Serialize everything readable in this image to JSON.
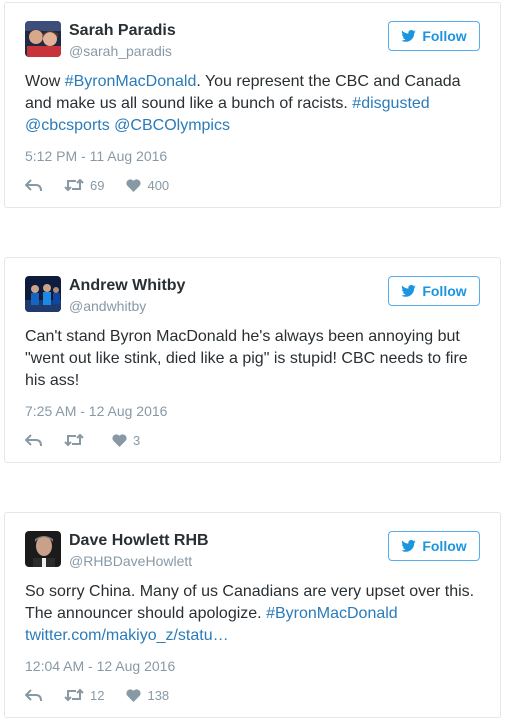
{
  "tweets": [
    {
      "name": "Sarah Paradis",
      "handle": "@sarah_paradis",
      "follow_label": "Follow",
      "body": [
        {
          "text": "Wow ",
          "link": false
        },
        {
          "text": "#ByronMacDonald",
          "link": true
        },
        {
          "text": ". You represent the CBC and Canada and make us all sound like a bunch of racists. ",
          "link": false
        },
        {
          "text": "#disgusted",
          "link": true
        },
        {
          "text": " ",
          "link": false
        },
        {
          "text": "@cbcsports",
          "link": true
        },
        {
          "text": " ",
          "link": false
        },
        {
          "text": "@CBCOlympics",
          "link": true
        }
      ],
      "timestamp": "5:12 PM - 11 Aug 2016",
      "retweets": "69",
      "likes": "400"
    },
    {
      "name": "Andrew Whitby",
      "handle": "@andwhitby",
      "follow_label": "Follow",
      "body": [
        {
          "text": "Can't stand Byron MacDonald he's always been annoying but \"went out like stink, died like a pig\" is stupid! CBC needs to fire his ass!",
          "link": false
        }
      ],
      "timestamp": "7:25 AM - 12 Aug 2016",
      "retweets": "",
      "likes": "3"
    },
    {
      "name": "Dave Howlett RHB",
      "handle": "@RHBDaveHowlett",
      "follow_label": "Follow",
      "body": [
        {
          "text": "So sorry China. Many of us Canadians are very upset over this. The announcer should apologize. ",
          "link": false
        },
        {
          "text": "#ByronMacDonald",
          "link": true
        },
        {
          "text": " ",
          "link": false
        },
        {
          "text": "twitter.com/makiyo_z/statu…",
          "link": true
        }
      ],
      "timestamp": "12:04 AM - 12 Aug 2016",
      "retweets": "12",
      "likes": "138"
    }
  ]
}
